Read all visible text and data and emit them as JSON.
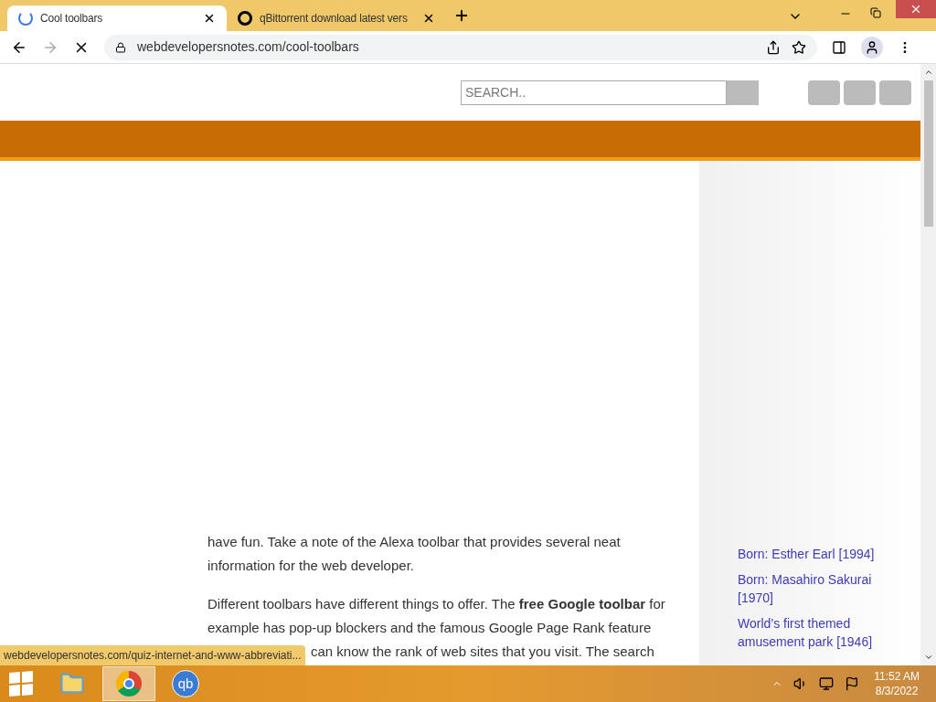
{
  "tabs": [
    {
      "title": "Cool toolbars",
      "selected": true,
      "kind": "loading"
    },
    {
      "title": "qBittorrent download latest vers",
      "selected": false,
      "kind": "favicon"
    }
  ],
  "address": {
    "url": "webdevelopersnotes.com/cool-toolbars"
  },
  "search": {
    "placeholder": "SEARCH.."
  },
  "article": {
    "paragraphs": [
      "have fun. Take a note of the Alexa toolbar that provides several neat information for the web developer.",
      "Different toolbars have different things to offer. The **free Google toolbar** for example has pop-up blockers and the famous Google Page Rank feature"
    ],
    "partial_line": "can know the rank of web sites that you visit. The search"
  },
  "sidebar": {
    "links": [
      "Born: Esther Earl [1994]",
      "Born: Masahiro Sakurai [1970]",
      "World’s first themed amusement park [1946]"
    ]
  },
  "status_bar": {
    "url": "webdevelopersnotes.com/quiz-internet-and-www-abbreviati..."
  },
  "taskbar": {
    "apps": [
      {
        "kind": "explorer",
        "selected": false
      },
      {
        "kind": "chrome",
        "selected": true
      },
      {
        "kind": "qbittorrent",
        "label": "qb",
        "selected": false
      }
    ],
    "time": "11:52 AM",
    "date": "8/3/2022"
  }
}
